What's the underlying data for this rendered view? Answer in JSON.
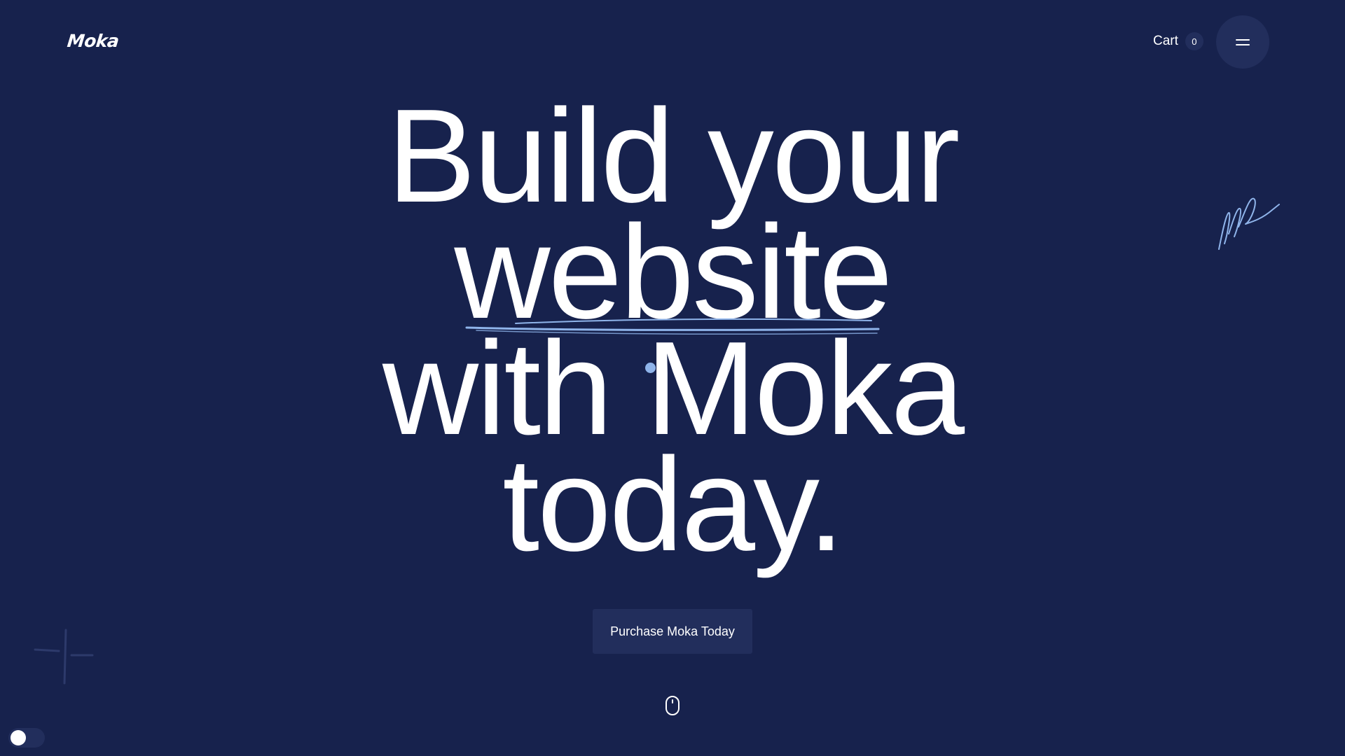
{
  "header": {
    "logo_text": "Moka",
    "cart_label": "Cart",
    "cart_count": "0",
    "menu_icon": "hamburger-icon"
  },
  "hero": {
    "lines": [
      "Build your",
      "website",
      "with Moka",
      "today."
    ],
    "cta_label": "Purchase Moka Today",
    "scroll_icon": "mouse-scroll-icon"
  },
  "decorations": {
    "squiggle_icon": "squiggle-doodle-icon",
    "sparkle_icon": "sparkle-icon"
  },
  "theme_toggle": {
    "state": "dark"
  },
  "colors": {
    "background": "#17224d",
    "surface": "#222e5c",
    "accent": "#8fb4ea",
    "text": "#ffffff"
  }
}
